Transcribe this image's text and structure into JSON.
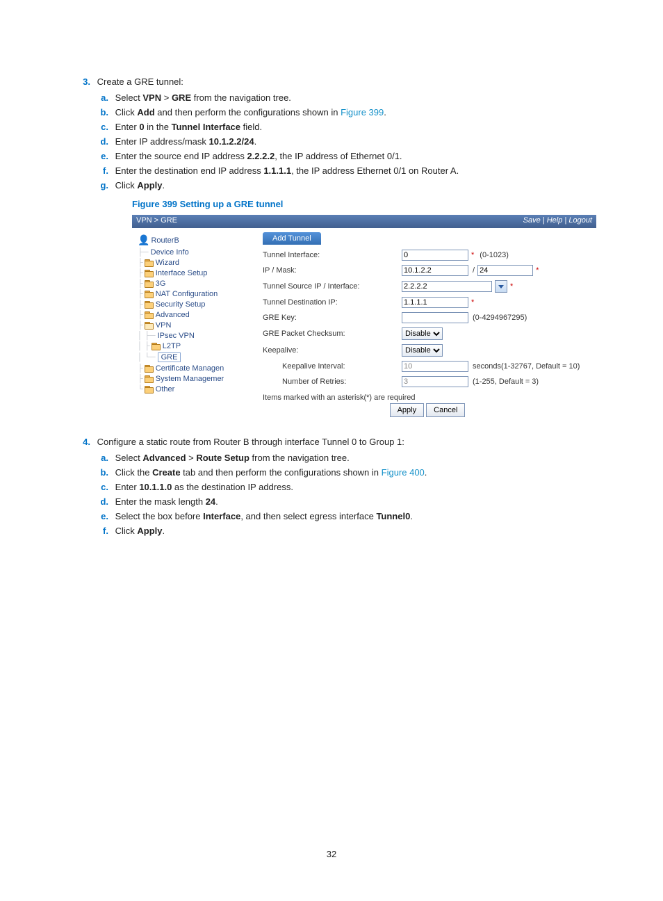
{
  "page_number": "32",
  "step3": {
    "num": "3.",
    "title": "Create a GRE tunnel:",
    "items": {
      "a_n": "a.",
      "a1": "Select ",
      "a2": "VPN",
      "a3": " > ",
      "a4": "GRE",
      "a5": " from the navigation tree.",
      "b_n": "b.",
      "b1": "Click ",
      "b2": "Add",
      "b3": " and then perform the configurations shown in ",
      "b4": "Figure 399",
      "b5": ".",
      "c_n": "c.",
      "c1": "Enter ",
      "c2": "0",
      "c3": " in the ",
      "c4": "Tunnel Interface",
      "c5": " field.",
      "d_n": "d.",
      "d1": "Enter IP address/mask ",
      "d2": "10.1.2.2/24",
      "d3": ".",
      "e_n": "e.",
      "e1": "Enter the source end IP address ",
      "e2": "2.2.2.2",
      "e3": ", the IP address of Ethernet 0/1.",
      "f_n": "f.",
      "f1": "Enter the destination end IP address ",
      "f2": "1.1.1.1",
      "f3": ", the IP address Ethernet 0/1 on Router A.",
      "g_n": "g.",
      "g1": "Click ",
      "g2": "Apply",
      "g3": "."
    }
  },
  "figure_caption": "Figure 399 Setting up a GRE tunnel",
  "shot": {
    "crumb": "VPN > GRE",
    "top_links": {
      "save": "Save",
      "help": "Help",
      "logout": "Logout",
      "sep": " | "
    },
    "nav": {
      "root": "RouterB",
      "items": [
        "Device Info",
        "Wizard",
        "Interface Setup",
        "3G",
        "NAT Configuration",
        "Security Setup",
        "Advanced",
        "VPN",
        "IPsec VPN",
        "L2TP",
        "GRE",
        "Certificate Managen",
        "System Managemer",
        "Other"
      ]
    },
    "tab": "Add Tunnel",
    "form": {
      "tunnel_interface": {
        "label": "Tunnel Interface:",
        "value": "0",
        "hint": "(0-1023)"
      },
      "ip_mask": {
        "label": "IP / Mask:",
        "ip": "10.1.2.2",
        "mask": "24",
        "slash": "/"
      },
      "tunnel_source": {
        "label": "Tunnel Source IP / Interface:",
        "value": "2.2.2.2"
      },
      "tunnel_dest": {
        "label": "Tunnel Destination IP:",
        "value": "1.1.1.1"
      },
      "gre_key": {
        "label": "GRE Key:",
        "value": "",
        "hint": "(0-4294967295)"
      },
      "checksum": {
        "label": "GRE Packet Checksum:",
        "value": "Disable"
      },
      "keepalive": {
        "label": "Keepalive:",
        "value": "Disable"
      },
      "ka_interval": {
        "label": "Keepalive Interval:",
        "value": "10",
        "hint": "seconds(1-32767, Default = 10)"
      },
      "retries": {
        "label": "Number of Retries:",
        "value": "3",
        "hint": "(1-255, Default = 3)"
      }
    },
    "required_note": "Items marked with an asterisk(*) are required",
    "apply": "Apply",
    "cancel": "Cancel",
    "star": "*"
  },
  "step4": {
    "num": "4.",
    "title": "Configure a static route from Router B through interface Tunnel 0 to Group 1:",
    "items": {
      "a_n": "a.",
      "a1": "Select ",
      "a2": "Advanced",
      "a3": " > ",
      "a4": "Route Setup",
      "a5": " from the navigation tree.",
      "b_n": "b.",
      "b1": "Click the ",
      "b2": "Create",
      "b3": " tab and then perform the configurations shown in ",
      "b4": "Figure 400",
      "b5": ".",
      "c_n": "c.",
      "c1": "Enter ",
      "c2": "10.1.1.0",
      "c3": " as the destination IP address.",
      "d_n": "d.",
      "d1": "Enter the mask length ",
      "d2": "24",
      "d3": ".",
      "e_n": "e.",
      "e1": "Select the box before ",
      "e2": "Interface",
      "e3": ", and then select egress interface ",
      "e4": "Tunnel0",
      "e5": ".",
      "f_n": "f.",
      "f1": "Click ",
      "f2": "Apply",
      "f3": "."
    }
  }
}
